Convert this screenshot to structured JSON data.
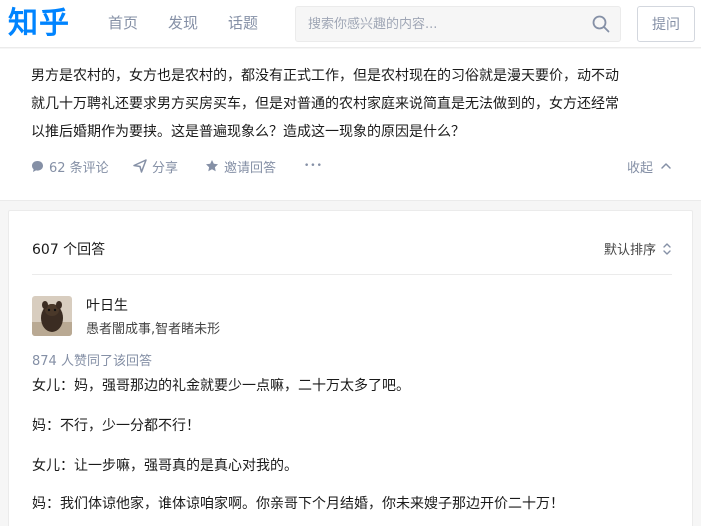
{
  "nav": {
    "logo": "知乎",
    "items": [
      {
        "label": "首页"
      },
      {
        "label": "发现"
      },
      {
        "label": "话题"
      }
    ],
    "search_placeholder": "搜索你感兴趣的内容...",
    "ask_label": "提问"
  },
  "question": {
    "lines": [
      "男方是农村的，女方也是农村的，都没有正式工作，但是农村现在的习俗就是漫天要价，动不动",
      "就几十万聘礼还要求男方买房买车，但是对普通的农村家庭来说简直是无法做到的，女方还经常",
      "以推后婚期作为要挟。这是普遍现象么？造成这一现象的原因是什么？"
    ],
    "actions": {
      "comments": "62 条评论",
      "share": "分享",
      "invite": "邀请回答",
      "more": "•••",
      "collapse": "收起"
    }
  },
  "answers": {
    "count_label": "607 个回答",
    "sort_label": "默认排序",
    "first": {
      "author": "叶日生",
      "bio": "愚者闇成事,智者睹未形",
      "votes": "874 人赞同了该回答",
      "paragraphs": [
        "女儿：妈，强哥那边的礼金就要少一点嘛，二十万太多了吧。",
        "妈：不行，少一分都不行！",
        "女儿：让一步嘛，强哥真的是真心对我的。",
        "妈：我们体谅他家，谁体谅咱家啊。你亲哥下个月结婚，你未来嫂子那边开价二十万！"
      ]
    }
  },
  "colors": {
    "brand": "#0084ff",
    "muted": "#8590a6"
  }
}
